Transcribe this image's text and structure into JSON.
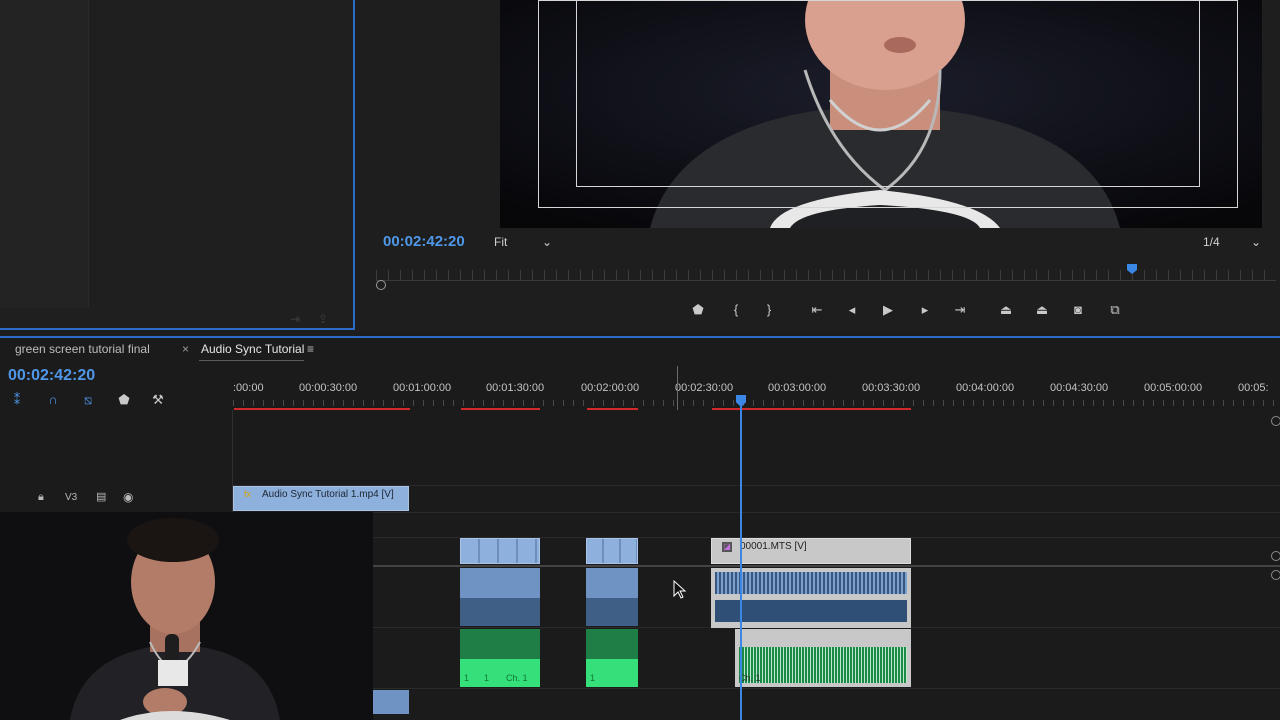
{
  "colors": {
    "accent_blue": "#4f97e8",
    "panel_border": "#2d6cc9",
    "render_red": "#d22a2a",
    "video_clip": "#8db0dc",
    "audio_green": "#1d8a48"
  },
  "program": {
    "timecode": "00:02:42:20",
    "zoom_label": "Fit",
    "resolution_label": "1/4",
    "playhead_fraction": 0.84,
    "controls": [
      "add-marker-icon",
      "mark-in-icon",
      "mark-out-icon",
      "go-to-in-icon",
      "step-back-icon",
      "play-icon",
      "step-forward-icon",
      "go-to-out-icon",
      "lift-icon",
      "extract-icon",
      "export-frame-icon",
      "compare-view-icon"
    ]
  },
  "timeline": {
    "tabs": [
      {
        "label": "green screen tutorial final"
      },
      {
        "label": "Audio Sync Tutorial",
        "close": "×",
        "menu": "≡"
      }
    ],
    "timecode": "00:02:42:20",
    "ruler": [
      ":00:00",
      "00:00:30:00",
      "00:01:00:00",
      "00:01:30:00",
      "00:02:00:00",
      "00:02:30:00",
      "00:03:00:00",
      "00:03:30:00",
      "00:04:00:00",
      "00:04:30:00",
      "00:05:00:00",
      "00:05:"
    ],
    "tools": [
      "snap-icon",
      "magnet-icon",
      "linked-selection-icon",
      "marker-icon",
      "wrench-icon"
    ],
    "track_v3": {
      "label": "V3"
    },
    "clips": {
      "top_clip": "Audio Sync Tutorial 1.mp4 [V]",
      "mts_clip": "00001.MTS [V]",
      "fx": "fx",
      "ch_labels": [
        "1",
        "1",
        "Ch. 1",
        "1",
        "Ch. 1"
      ]
    }
  }
}
